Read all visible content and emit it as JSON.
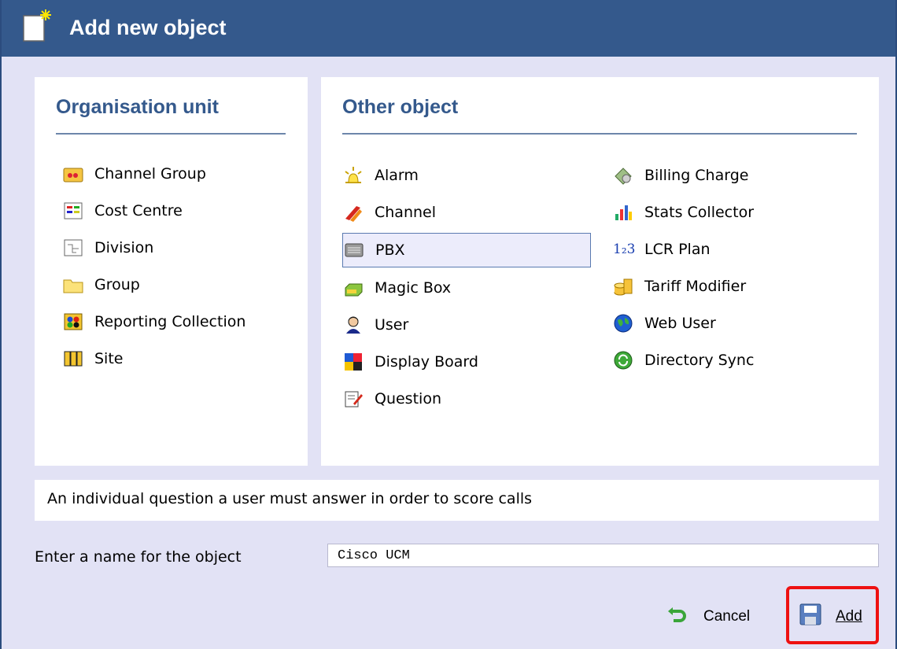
{
  "window": {
    "title": "Add new object",
    "icon": "new-object-sparkle-icon"
  },
  "org_panel": {
    "heading": "Organisation unit",
    "items": [
      {
        "label": "Channel Group",
        "icon": "channel-group-icon"
      },
      {
        "label": "Cost Centre",
        "icon": "cost-centre-icon"
      },
      {
        "label": "Division",
        "icon": "division-icon"
      },
      {
        "label": "Group",
        "icon": "folder-icon"
      },
      {
        "label": "Reporting Collection",
        "icon": "reporting-collection-icon"
      },
      {
        "label": "Site",
        "icon": "site-icon"
      }
    ]
  },
  "other_panel": {
    "heading": "Other object",
    "col1": [
      {
        "label": "Alarm",
        "icon": "alarm-icon"
      },
      {
        "label": "Channel",
        "icon": "channel-icon"
      },
      {
        "label": "PBX",
        "icon": "pbx-icon",
        "selected": true
      },
      {
        "label": "Magic Box",
        "icon": "magic-box-icon"
      },
      {
        "label": "User",
        "icon": "user-icon"
      },
      {
        "label": "Display Board",
        "icon": "display-board-icon"
      },
      {
        "label": "Question",
        "icon": "question-icon"
      }
    ],
    "col2": [
      {
        "label": "Billing Charge",
        "icon": "billing-charge-icon"
      },
      {
        "label": "Stats Collector",
        "icon": "stats-collector-icon"
      },
      {
        "label": "LCR Plan",
        "icon": "lcr-plan-icon",
        "icon_text": "1₂3"
      },
      {
        "label": "Tariff Modifier",
        "icon": "tariff-modifier-icon"
      },
      {
        "label": "Web User",
        "icon": "web-user-icon"
      },
      {
        "label": "Directory Sync",
        "icon": "directory-sync-icon"
      }
    ]
  },
  "description": "An individual question a user must answer in order to score calls",
  "name_field": {
    "label": "Enter a name for the object",
    "value": "Cisco UCM"
  },
  "buttons": {
    "cancel": "Cancel",
    "add": "Add"
  },
  "colors": {
    "titlebar": "#34598c",
    "heading": "#34598c",
    "background": "#e2e2f5",
    "highlight": "#ee1111"
  }
}
